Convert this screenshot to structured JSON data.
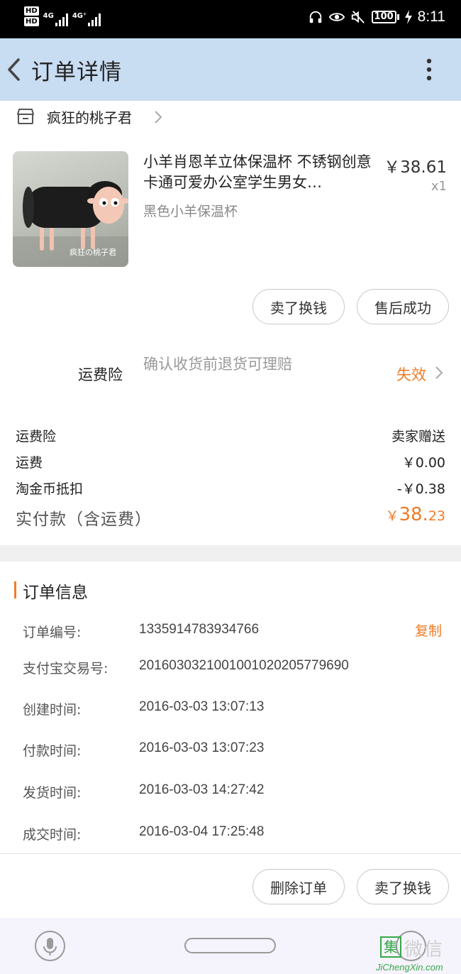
{
  "status_bar": {
    "hd1": "HD",
    "hd2": "HD",
    "net1": "4G",
    "net2": "4G⁺",
    "battery": "100",
    "time": "8:11"
  },
  "header": {
    "title": "订单详情",
    "back_icon": "chevron-left-icon",
    "more_icon": "more-vertical-icon"
  },
  "shop": {
    "name": "疯狂的桃子君",
    "icon": "store-icon"
  },
  "product": {
    "title": "小羊肖恩羊立体保温杯 不锈钢创意卡通可爱办公室学生男女…",
    "sku": "黑色小羊保温杯",
    "price": "￥38.61",
    "qty": "x1",
    "image_caption": "疯狂の桃子君"
  },
  "item_actions": {
    "sell_label": "卖了换钱",
    "aftersale_label": "售后成功"
  },
  "insurance": {
    "label": "运费险",
    "description": "确认收货前退货可理赔",
    "status": "失效"
  },
  "fees": {
    "rows": [
      {
        "label": "运费险",
        "value": "卖家赠送"
      },
      {
        "label": "运费",
        "value": "￥0.00"
      },
      {
        "label": "淘金币抵扣",
        "value": "-￥0.38"
      }
    ],
    "total_label": "实付款（含运费）",
    "total_currency": "￥",
    "total_integer": "38.",
    "total_decimal": "23",
    "accent_color": "#f07b28"
  },
  "order_info": {
    "title": "订单信息",
    "copy_label": "复制",
    "rows": [
      {
        "label": "订单编号:",
        "value": "1335914783934766"
      },
      {
        "label": "支付宝交易号:",
        "value": "2016030321001001020205779690"
      },
      {
        "label": "创建时间:",
        "value": "2016-03-03 13:07:13"
      },
      {
        "label": "付款时间:",
        "value": "2016-03-03 13:07:23"
      },
      {
        "label": "发货时间:",
        "value": "2016-03-03 14:27:42"
      },
      {
        "label": "成交时间:",
        "value": "2016-03-04 17:25:48"
      }
    ]
  },
  "bottom_actions": {
    "delete_label": "删除订单",
    "sell_label": "卖了换钱"
  },
  "watermark": {
    "glyph": "集",
    "text": "微信",
    "url": "JiChengXin.com"
  }
}
